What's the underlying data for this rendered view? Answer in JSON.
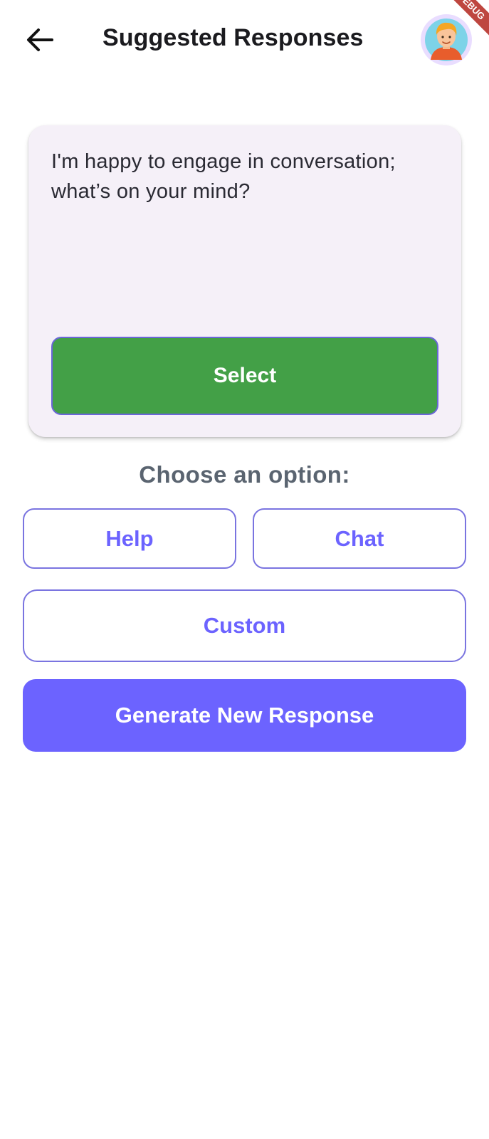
{
  "appbar": {
    "title": "Suggested Responses",
    "back_icon": "arrow-left-icon",
    "avatar_icon": "user-avatar-icon",
    "debug_banner": "DEBUG"
  },
  "card": {
    "response_text": "I'm happy to engage in conversation; what’s on your mind?",
    "select_label": "Select"
  },
  "options": {
    "heading": "Choose an option:",
    "help_label": "Help",
    "chat_label": "Chat",
    "custom_label": "Custom"
  },
  "generate": {
    "label": "Generate New Response"
  },
  "colors": {
    "accent": "#6c63ff",
    "select_green": "#43a047",
    "card_bg": "#f5f0f8",
    "heading_gray": "#5a6470"
  }
}
